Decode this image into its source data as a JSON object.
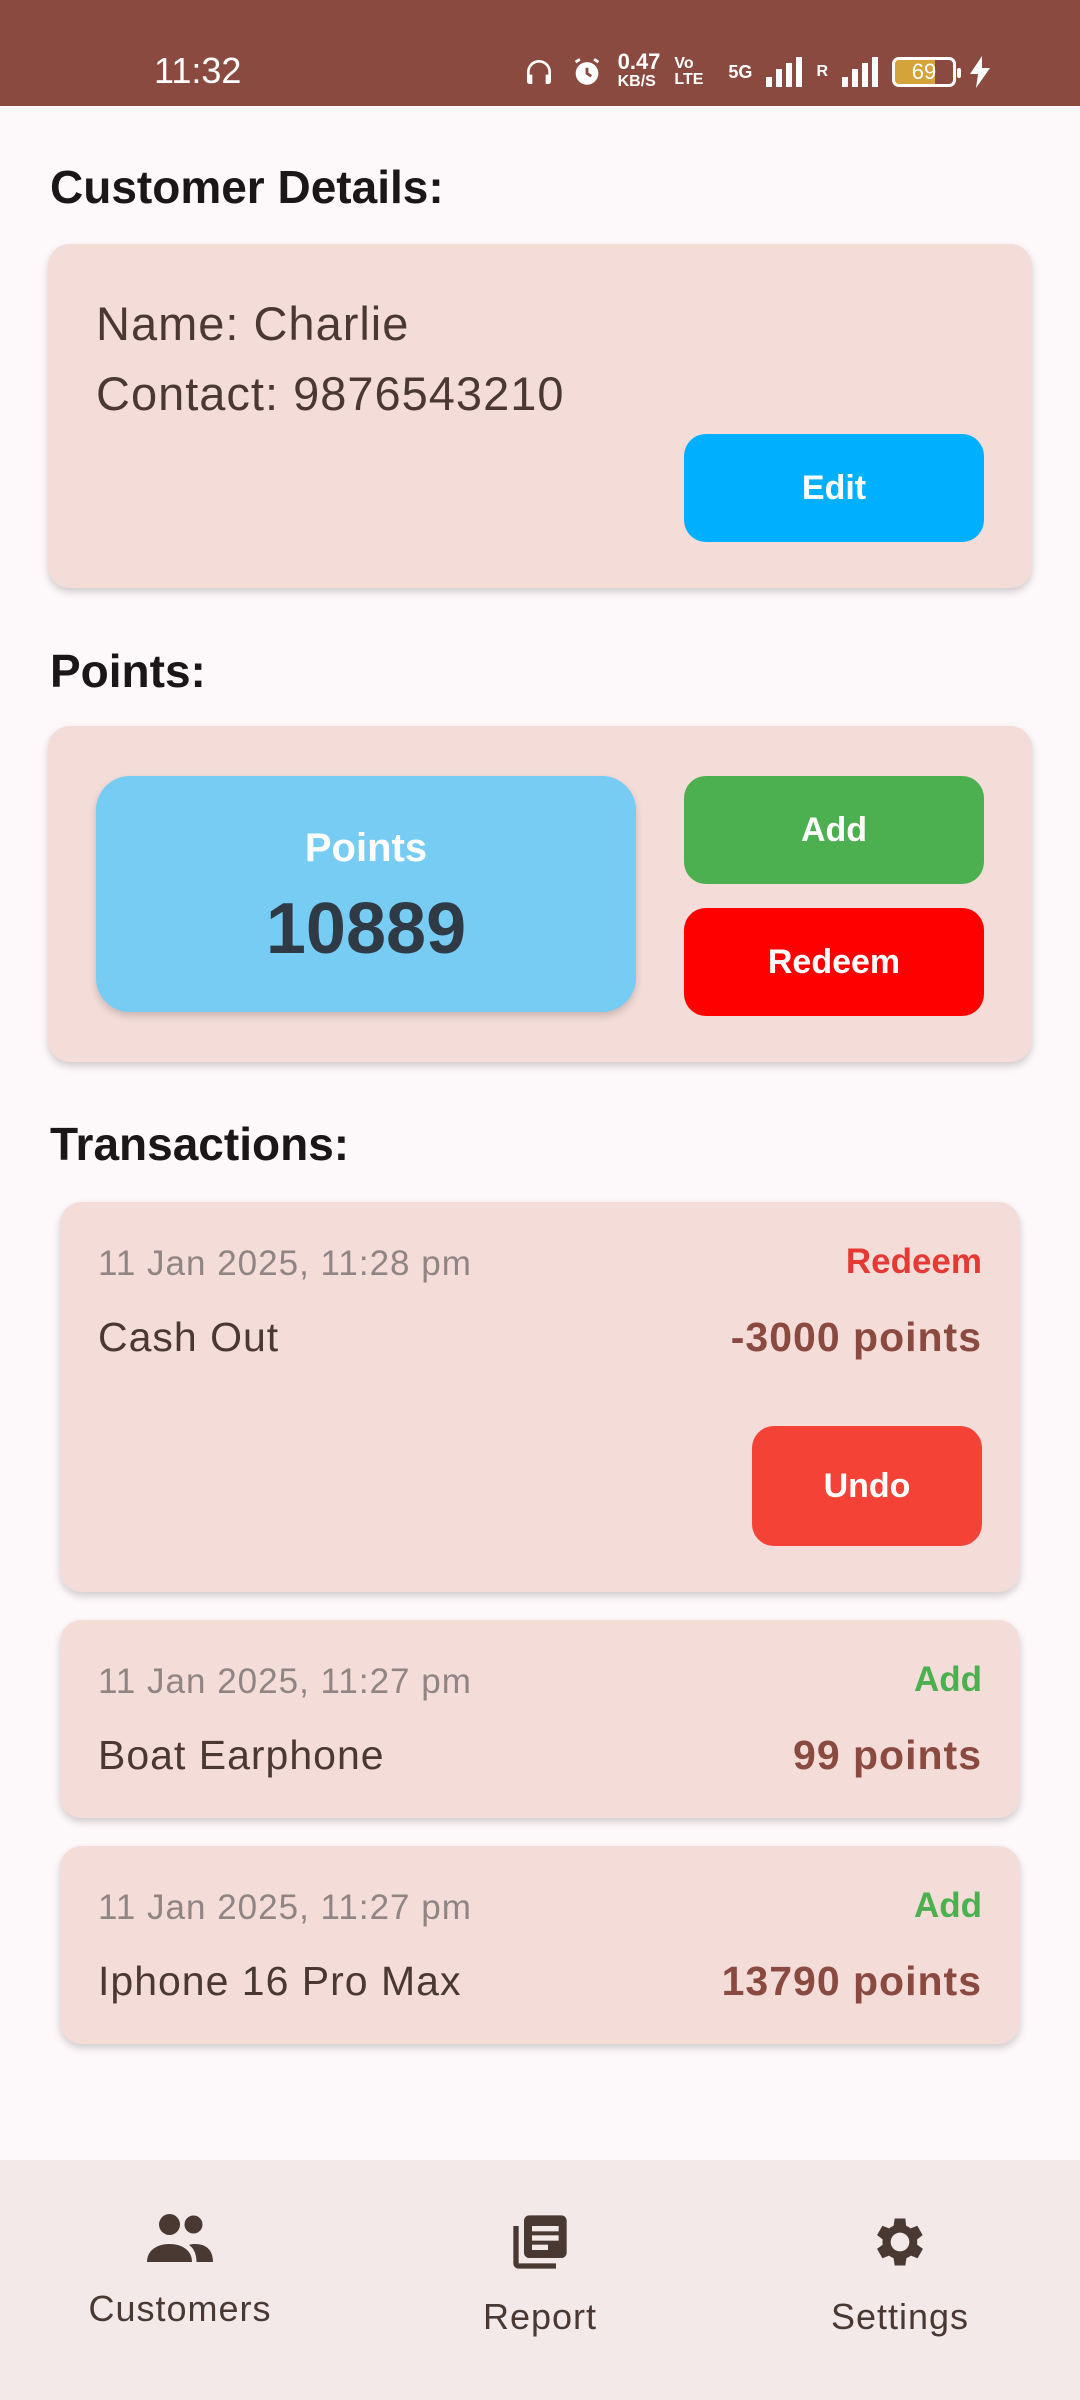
{
  "status_bar": {
    "time": "11:32",
    "net_speed_value": "0.47",
    "net_speed_unit": "KB/S",
    "volte": "Vo LTE",
    "network": "5G",
    "roaming": "R",
    "battery": "69"
  },
  "customer": {
    "section_title": "Customer Details:",
    "name_line": "Name: Charlie",
    "contact_line": "Contact: 9876543210",
    "edit_label": "Edit"
  },
  "points": {
    "section_title": "Points:",
    "label": "Points",
    "value": "10889",
    "add_label": "Add",
    "redeem_label": "Redeem"
  },
  "transactions": {
    "section_title": "Transactions:",
    "items": [
      {
        "date": "11 Jan 2025, 11:28 pm",
        "type": "Redeem",
        "description": "Cash Out",
        "points": "-3000 points",
        "undo_label": "Undo"
      },
      {
        "date": "11 Jan 2025, 11:27 pm",
        "type": "Add",
        "description": "Boat Earphone",
        "points": "99 points"
      },
      {
        "date": "11 Jan 2025, 11:27 pm",
        "type": "Add",
        "description": "Iphone 16 Pro Max",
        "points": "13790 points"
      }
    ]
  },
  "bottom_nav": {
    "items": [
      {
        "label": "Customers",
        "icon": "people-icon"
      },
      {
        "label": "Report",
        "icon": "report-icon"
      },
      {
        "label": "Settings",
        "icon": "gear-icon"
      }
    ]
  },
  "colors": {
    "status_bar": "#8b4a40",
    "card": "#f4ddd9",
    "edit_button": "#00b0ff",
    "add_button": "#4caf50",
    "redeem_button": "#ff0000",
    "undo_button": "#f44336",
    "points_box": "#76ccf3",
    "redeem_type": "#e53935",
    "add_type": "#4caf50"
  }
}
